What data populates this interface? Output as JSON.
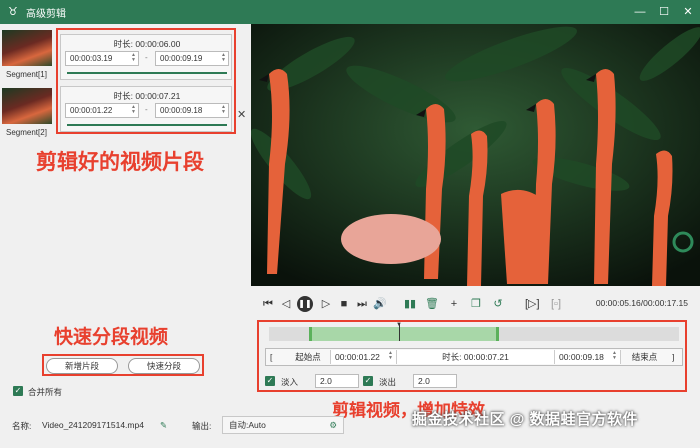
{
  "titlebar": {
    "title": "高级剪辑",
    "bg": "#2e7a55"
  },
  "segments": {
    "thumbs": [
      {
        "label": "Segment[1]"
      },
      {
        "label": "Segment[2]"
      }
    ],
    "cards": [
      {
        "duration_label": "时长:",
        "duration": "00:00:06.00",
        "start": "00:00:03.19",
        "end": "00:00:09.19",
        "dash": "-"
      },
      {
        "duration_label": "时长:",
        "duration": "00:00:07.21",
        "start": "00:00:01.22",
        "end": "00:00:09.18",
        "dash": "-"
      }
    ]
  },
  "annotations": {
    "segments_note": "剪辑好的视频片段",
    "split_note": "快速分段视频",
    "edit_note": "剪辑视频，增加特效",
    "color": "#e8402e"
  },
  "buttons": {
    "add_segment": "新增片段",
    "quick_split": "快速分段"
  },
  "merge_all": {
    "label": "合并所有",
    "checked": true
  },
  "player": {
    "time": "00:00:05.16/00:00:17.15"
  },
  "trim": {
    "start_bracket": "[",
    "start_label": "起始点",
    "start": "00:00:01.22",
    "duration_label": "时长:",
    "duration": "00:00:07.21",
    "end": "00:00:09.18",
    "end_label": "结束点",
    "end_bracket": "]"
  },
  "effects": {
    "fade_in_label": "淡入",
    "fade_in": "2.0",
    "fade_in_checked": true,
    "fade_out_label": "淡出",
    "fade_out": "2.0",
    "fade_out_checked": true
  },
  "footer": {
    "name_label": "名称:",
    "name_value": "Video_241209171514.mp4",
    "output_label": "输出:",
    "output_value": "自动:Auto"
  },
  "watermark": "掘金技术社区 @ 数据蛙官方软件",
  "icons": {
    "minimize": "minimize-icon",
    "maximize": "maximize-icon",
    "close": "close-icon",
    "edit": "pencil-icon",
    "settings": "gear-icon"
  }
}
